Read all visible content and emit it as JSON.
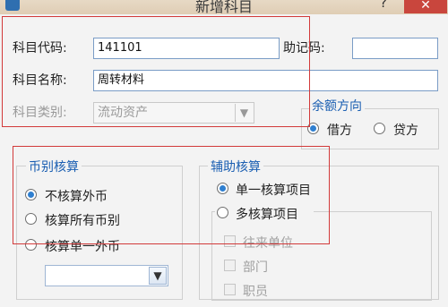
{
  "window": {
    "title": "新增科目",
    "help_label": "?",
    "close_label": "✕",
    "app_icon": "app-icon"
  },
  "form": {
    "code_label": "科目代码:",
    "code_value": "141101",
    "mnemonic_label": "助记码:",
    "mnemonic_value": "",
    "name_label": "科目名称:",
    "name_value": "周转材料",
    "category_label": "科目类别:",
    "category_value": "流动资产"
  },
  "balance": {
    "legend": "余额方向",
    "options": [
      "借方",
      "贷方"
    ],
    "selected": "借方"
  },
  "currency": {
    "legend": "币别核算",
    "options": [
      "不核算外币",
      "核算所有币别",
      "核算单一外币"
    ],
    "selected": "不核算外币",
    "currency_select_value": ""
  },
  "auxiliary": {
    "legend": "辅助核算",
    "options": [
      "单一核算项目",
      "多核算项目"
    ],
    "selected": "单一核算项目",
    "items": [
      "往来单位",
      "部门",
      "职员"
    ]
  },
  "colors": {
    "highlight": "#d23a3a",
    "legend_blue": "#1b5fb2",
    "close_red": "#c9463d"
  }
}
